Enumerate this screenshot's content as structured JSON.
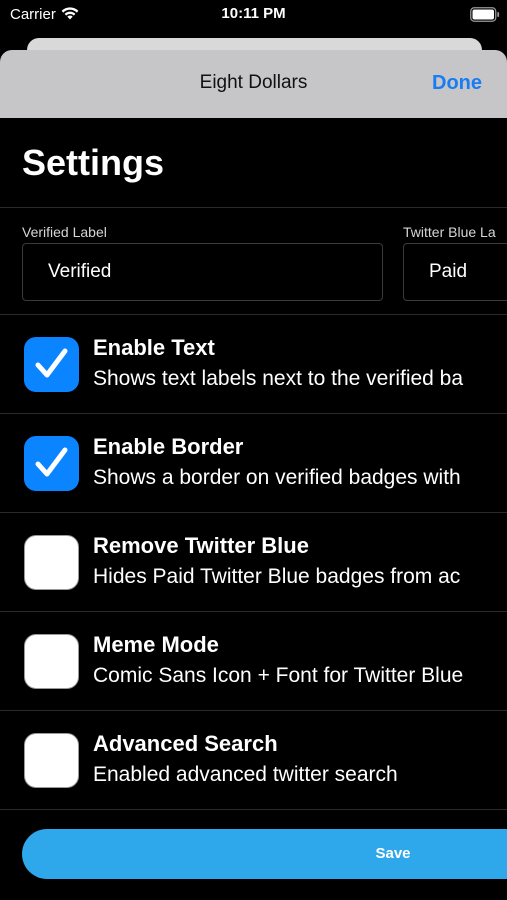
{
  "status_bar": {
    "carrier": "Carrier",
    "time": "10:11 PM"
  },
  "nav": {
    "title": "Eight Dollars",
    "done_label": "Done"
  },
  "page": {
    "title": "Settings"
  },
  "fields": {
    "verified_label": {
      "label": "Verified Label",
      "value": "Verified"
    },
    "twitter_blue_label": {
      "label": "Twitter Blue La",
      "value": "Paid"
    }
  },
  "options": [
    {
      "title": "Enable Text",
      "subtitle": "Shows text labels next to the verified ba",
      "checked": true
    },
    {
      "title": "Enable Border",
      "subtitle": "Shows a border on verified badges with",
      "checked": true
    },
    {
      "title": "Remove Twitter Blue",
      "subtitle": "Hides Paid Twitter Blue badges from ac",
      "checked": false
    },
    {
      "title": "Meme Mode",
      "subtitle": "Comic Sans Icon + Font for Twitter Blue",
      "checked": false
    },
    {
      "title": "Advanced Search",
      "subtitle": "Enabled advanced twitter search",
      "checked": false
    }
  ],
  "actions": {
    "save_label": "Save"
  },
  "colors": {
    "accent": "#0a84ff",
    "done_text": "#1a7cf2",
    "save_button": "#2ea8ea",
    "nav_background": "#c6c6c8",
    "background": "#000000"
  }
}
